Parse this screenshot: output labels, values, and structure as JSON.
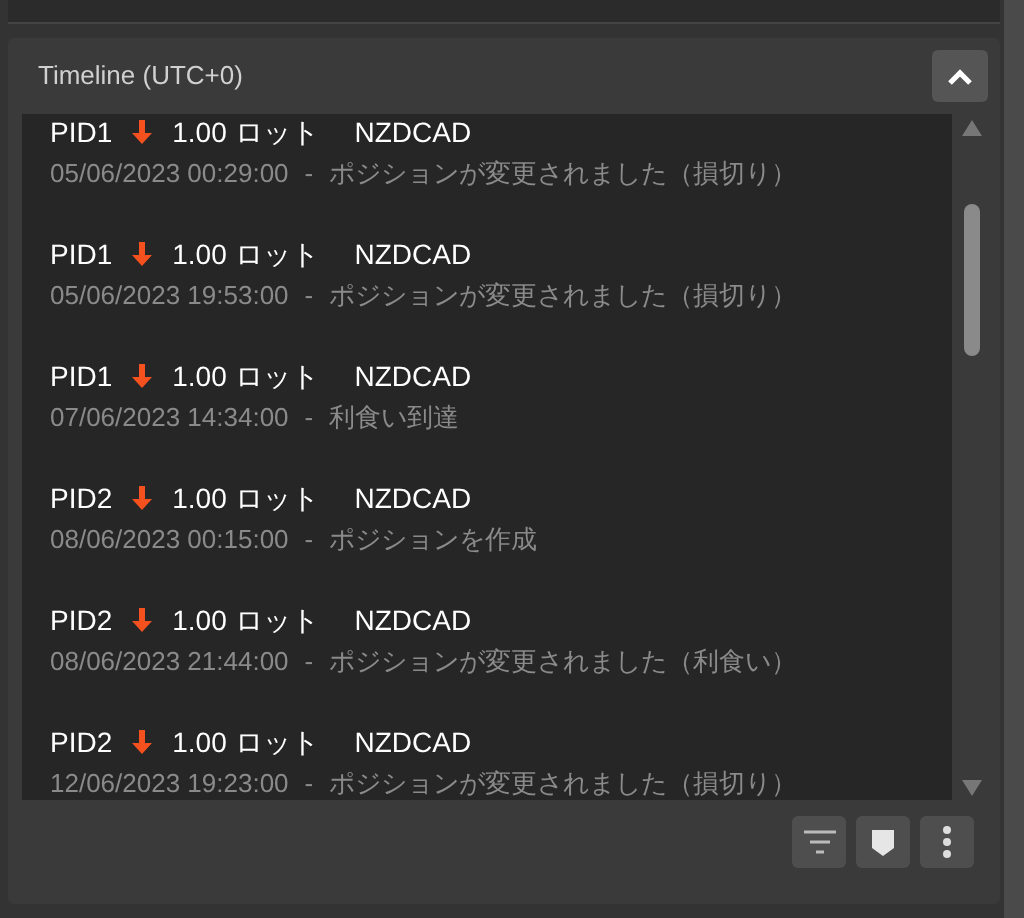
{
  "panel": {
    "title": "Timeline (UTC+0)",
    "expanded": true
  },
  "entries": [
    {
      "position": "PID1",
      "falling": true,
      "lots": "1.00 ロット",
      "symbol": "NZDCAD",
      "time": "05/06/2023 00:29:00",
      "separator": "-",
      "event": "ポジションが変更されました（損切り）"
    },
    {
      "position": "PID1",
      "falling": true,
      "lots": "1.00 ロット",
      "symbol": "NZDCAD",
      "time": "05/06/2023 19:53:00",
      "separator": "-",
      "event": "ポジションが変更されました（損切り）"
    },
    {
      "position": "PID1",
      "falling": true,
      "lots": "1.00 ロット",
      "symbol": "NZDCAD",
      "time": "07/06/2023 14:34:00",
      "separator": "-",
      "event": "利食い到達"
    },
    {
      "position": "PID2",
      "falling": true,
      "lots": "1.00 ロット",
      "symbol": "NZDCAD",
      "time": "08/06/2023 00:15:00",
      "separator": "-",
      "event": "ポジションを作成"
    },
    {
      "position": "PID2",
      "falling": true,
      "lots": "1.00 ロット",
      "symbol": "NZDCAD",
      "time": "08/06/2023 21:44:00",
      "separator": "-",
      "event": "ポジションが変更されました（利食い）"
    },
    {
      "position": "PID2",
      "falling": true,
      "lots": "1.00 ロット",
      "symbol": "NZDCAD",
      "time": "12/06/2023 19:23:00",
      "separator": "-",
      "event": "ポジションが変更されました（損切り）"
    }
  ]
}
